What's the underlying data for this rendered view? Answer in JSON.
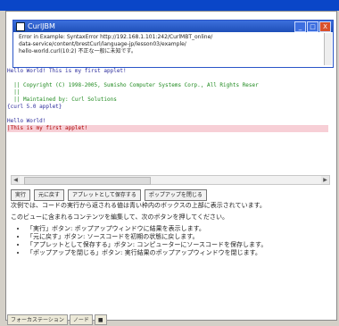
{
  "popup": {
    "title": "CurlJBM",
    "lines": [
      "Error in Example: SyntaxError http://192.168.1.101:242/CurlMBT_online/",
      "data-service/content/brestCurl/language-jp/lesson03/example/",
      "hello-world.curl(10:2) 不正な一般に未知です。"
    ],
    "min": "_",
    "max": "□",
    "close": "X"
  },
  "code_lines": [
    {
      "text": "Hello World! This is my first applet!",
      "style": "plain"
    },
    {
      "text": "",
      "style": "plain"
    },
    {
      "text": "  || Copyright (C) 1998-2005, Sumisho Computer Systems Corp., All Rights Reser",
      "style": "green"
    },
    {
      "text": "  ||",
      "style": "green"
    },
    {
      "text": "  || Maintained by: Curl Solutions",
      "style": "green"
    },
    {
      "text": "{curl 5.0 applet}",
      "style": "plain"
    },
    {
      "text": "",
      "style": "plain"
    },
    {
      "text": "Hello World!",
      "style": "plain"
    },
    {
      "text": "|This is my first applet!",
      "style": "hl"
    }
  ],
  "toolbar": {
    "run": "実行",
    "restore": "元に戻す",
    "save_applet": "アプレットとして保存する",
    "close_popup": "ポップアップを閉じる"
  },
  "description": {
    "p1": "次例では、コードの実行から返される値は青い枠内のボックスの上部に表示されています。",
    "p2": "このビューに含まれるコンテンツを編集して、次のボタンを押してください。",
    "items": [
      "「実行」ボタン: ポップアップウィンドウに結果を表示します。",
      "「元に戻す」ボタン: ソースコードを初期の状態に戻します。",
      "「アプレットとして保存する」ボタン: コンピューターにソースコードを保存します。",
      "「ポップアップを閉じる」ボタン: 実行結果のポップアップウィンドウを閉じます。"
    ]
  },
  "status": {
    "tab1": "フォーカステーション",
    "tab2": "ノード",
    "tab3": "■"
  }
}
